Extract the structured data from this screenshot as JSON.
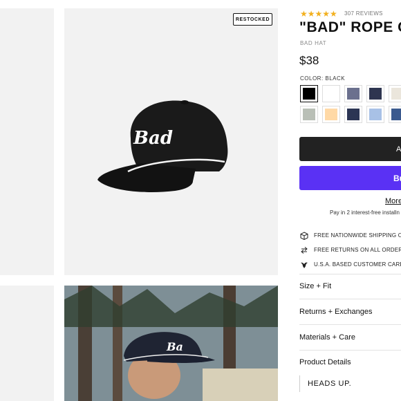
{
  "gallery": {
    "badge": "RESTOCKED",
    "hat_logo_text": "Bad"
  },
  "product": {
    "stars": "★★★★★",
    "review_count": "307 REVIEWS",
    "title": "\"BAD\" ROPE G",
    "brand": "BAD HAT",
    "price": "$38",
    "color_label": "COLOR: BLACK",
    "rating_color": "#f2b01e"
  },
  "swatches": {
    "row1": [
      "#000000",
      "#ffffff",
      "#6b708e",
      "#2e3550",
      "#ebe6dc"
    ],
    "row2": [
      "#b9bfb6",
      "#ffd9a6",
      "#2c3554",
      "#a8c1e6",
      "#3b5a8f"
    ]
  },
  "buttons": {
    "add_label": "A",
    "buy_label": "Bu",
    "more_options": "More",
    "installments": "Pay in 2 interest-free installn"
  },
  "features": [
    {
      "icon": "box-icon",
      "text": "FREE NATIONWIDE SHIPPING ON"
    },
    {
      "icon": "return-arrows-icon",
      "text": "FREE RETURNS ON ALL ORDERS"
    },
    {
      "icon": "eagle-icon",
      "text": "U.S.A. BASED CUSTOMER CARE"
    }
  ],
  "accordion": [
    "Size + Fit",
    "Returns + Exchanges",
    "Materials + Care",
    "Product Details"
  ],
  "details": {
    "heads_up": "HEADS UP."
  },
  "colors": {
    "buy_button": "#5a31f4",
    "add_button": "#222222"
  }
}
